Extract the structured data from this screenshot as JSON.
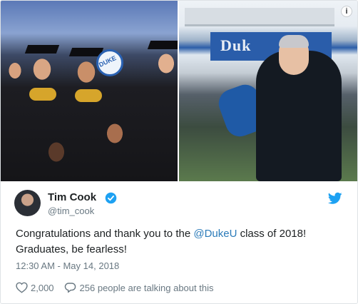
{
  "photos": {
    "left_sign_text": "DUKE",
    "right_banner_text": "Duk"
  },
  "info_icon_glyph": "i",
  "tweet": {
    "author_name": "Tim Cook",
    "author_handle": "@tim_cook",
    "text_line1_before": "Congratulations and thank you to the ",
    "mention": "@DukeU",
    "text_line1_after": " class of 2018!",
    "text_line2": "Graduates, be fearless!",
    "timestamp": "12:30 AM - May 14, 2018",
    "likes": "2,000",
    "talking": "256 people are talking about this"
  },
  "colors": {
    "link": "#2b7bb9",
    "verified": "#1da1f2",
    "twitter_bird": "#1da1f2",
    "secondary_text": "#697882"
  },
  "icons": [
    "info-icon",
    "avatar",
    "verified-badge-icon",
    "twitter-bird-icon",
    "heart-icon",
    "reply-bubble-icon"
  ]
}
